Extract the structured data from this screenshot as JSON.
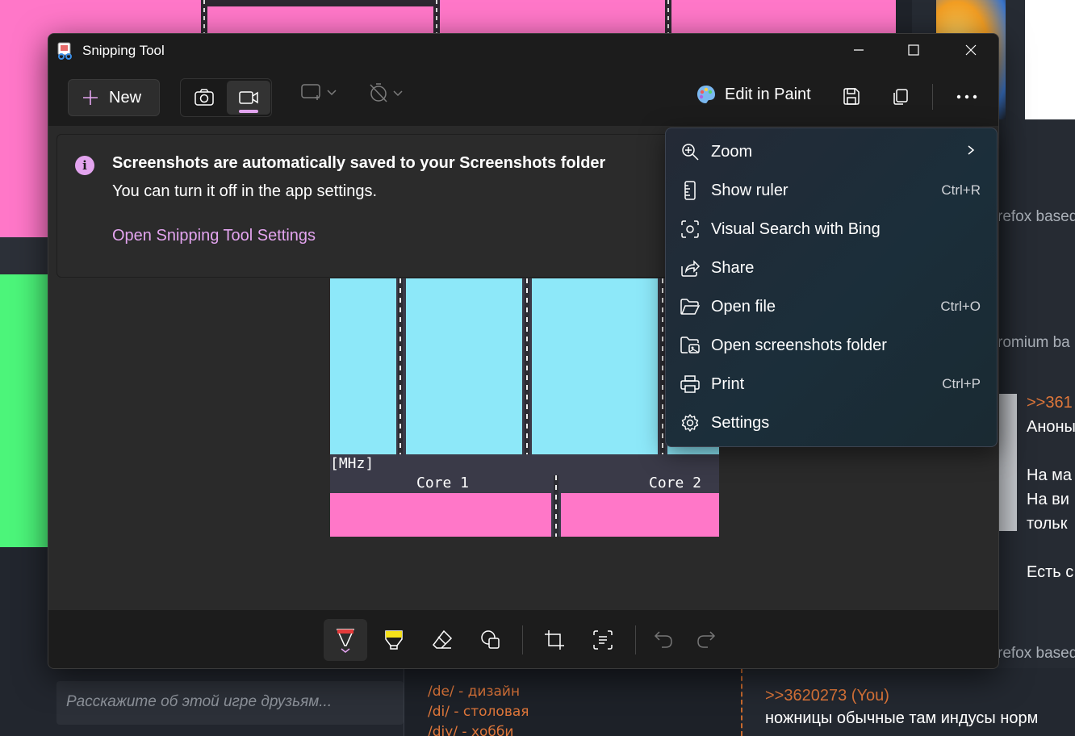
{
  "app": {
    "title": "Snipping Tool"
  },
  "toolbar": {
    "new_label": "New",
    "edit_paint_label": "Edit in Paint"
  },
  "banner": {
    "title": "Screenshots are automatically saved to your Screenshots folder",
    "text": "You can turn it off in the app settings.",
    "link": "Open Snipping Tool Settings"
  },
  "screenshot": {
    "unit_label": "[MHz]",
    "core1": "Core 1",
    "core2": "Core 2"
  },
  "menu": {
    "items": [
      {
        "label": "Zoom",
        "shortcut": "",
        "icon": "zoom-in-icon"
      },
      {
        "label": "Show ruler",
        "shortcut": "Ctrl+R",
        "icon": "ruler-icon"
      },
      {
        "label": "Visual Search with Bing",
        "shortcut": "",
        "icon": "visual-search-icon"
      },
      {
        "label": "Share",
        "shortcut": "",
        "icon": "share-icon"
      },
      {
        "label": "Open file",
        "shortcut": "Ctrl+O",
        "icon": "folder-open-icon"
      },
      {
        "label": "Open screenshots folder",
        "shortcut": "",
        "icon": "folder-image-icon"
      },
      {
        "label": "Print",
        "shortcut": "Ctrl+P",
        "icon": "print-icon"
      },
      {
        "label": "Settings",
        "shortcut": "",
        "icon": "gear-icon"
      }
    ]
  },
  "background": {
    "chat_placeholder": "Расскажите об этой игре друзьям...",
    "boards": [
      "/de/ - дизайн",
      "/di/ - столовая",
      "/diy/ - хобби"
    ],
    "right_snippets": [
      "refox based",
      "romium ba",
      "refox based"
    ],
    "post_bottom_ref": ">>3620273 (You)",
    "post_bottom_text": "ножницы обычные там индусы норм",
    "post_right_lines": [
      ">>361",
      "Аноны",
      "",
      "На ма",
      "На ви",
      "тольк",
      "",
      "Есть с"
    ]
  },
  "colors": {
    "accent": "#e3a4ef",
    "pink": "#ff77c8",
    "cyan": "#8de8f9",
    "green": "#4cf57a",
    "orange": "#e0773a"
  }
}
